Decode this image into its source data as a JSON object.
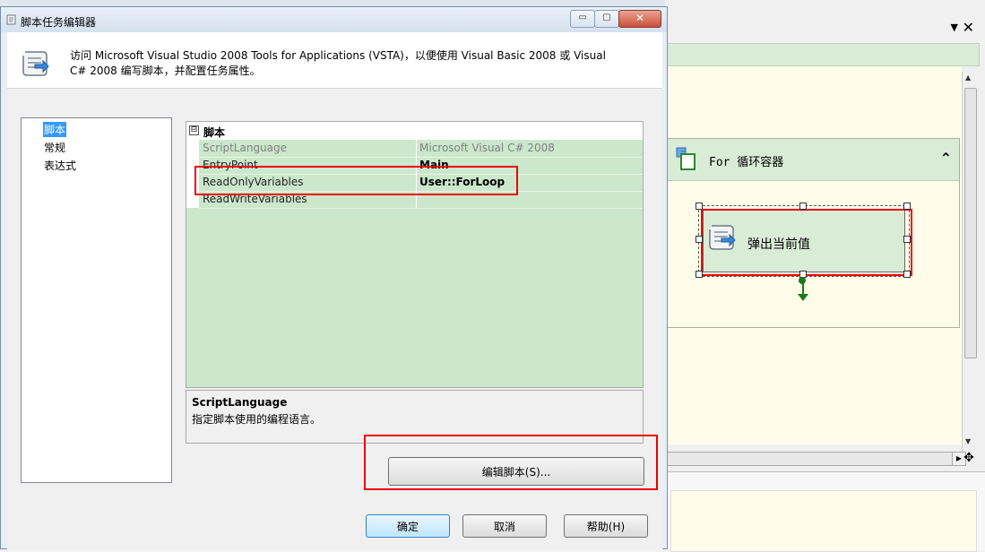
{
  "dialog": {
    "title": "脚本任务编辑器",
    "description": "访问 Microsoft Visual Studio 2008 Tools for Applications (VSTA)，以便使用 Visual Basic 2008 或 Visual C# 2008 编写脚本，并配置任务属性。",
    "window_buttons": {
      "min": "▭",
      "max": "▢",
      "close": "✕"
    }
  },
  "nav": {
    "items": [
      {
        "label": "脚本",
        "selected": true
      },
      {
        "label": "常规",
        "selected": false
      },
      {
        "label": "表达式",
        "selected": false
      }
    ]
  },
  "property_grid": {
    "category": "脚本",
    "toggle": "⊟",
    "rows": [
      {
        "name": "ScriptLanguage",
        "value": "Microsoft Visual C# 2008"
      },
      {
        "name": "EntryPoint",
        "value": "Main"
      },
      {
        "name": "ReadOnlyVariables",
        "value": "User::ForLoop"
      },
      {
        "name": "ReadWriteVariables",
        "value": ""
      }
    ]
  },
  "help": {
    "title": "ScriptLanguage",
    "description": "指定脚本使用的编程语言。"
  },
  "buttons": {
    "edit_script": "编辑脚本(S)...",
    "ok": "确定",
    "cancel": "取消",
    "help": "帮助(H)"
  },
  "designer": {
    "dropdown_glyph": "▼",
    "close_glyph": "✕",
    "for_container_title": "For 循环容器",
    "collapse_glyph": "⌃",
    "task_label": "弹出当前值"
  },
  "colors": {
    "highlight_red": "#e00000",
    "grid_green": "#cce8cc",
    "container_green": "#d9ecd6",
    "canvas_yellow": "#fffdea",
    "selection_blue": "#3399ff"
  }
}
